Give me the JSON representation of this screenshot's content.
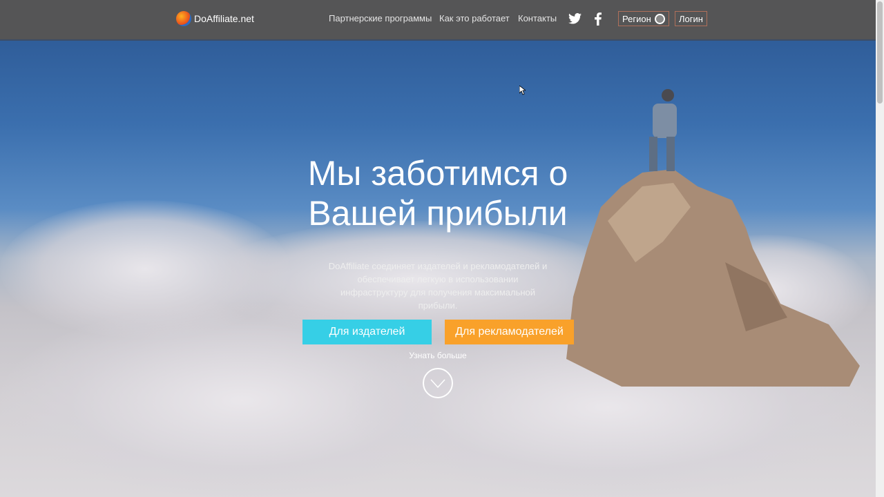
{
  "header": {
    "logo": "DoAffiliate.net",
    "menu": [
      "Партнерские программы",
      "Как это работает",
      "Контакты"
    ],
    "region_label": "Регион",
    "login_label": "Логин"
  },
  "hero": {
    "title_line1": "Мы заботимся о",
    "title_line2": "Вашей прибыли",
    "description": "DoAffiliate соединяет издателей и рекламодателей и обеспечивает легкую в использовании инфраструктуру для получения максимальной прибыли.",
    "publishers_button": "Для издателей",
    "advertisers_button": "Для рекламодателей",
    "learn_more": "Узнать больше"
  },
  "colors": {
    "publishers": "#36cfe6",
    "advertisers": "#f9a12a",
    "nav": "#555556"
  }
}
